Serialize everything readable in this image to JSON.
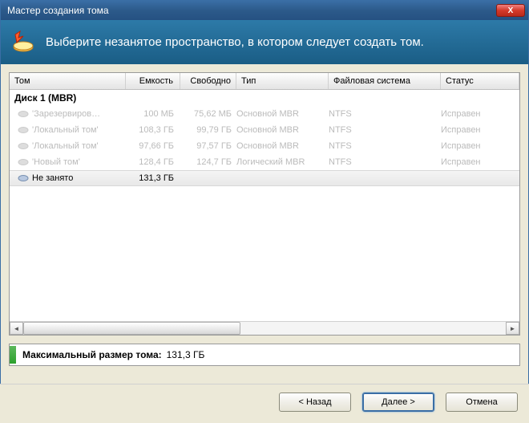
{
  "window": {
    "title": "Мастер создания тома",
    "close_x": "X"
  },
  "banner": {
    "text": "Выберите незанятое пространство, в котором следует создать том."
  },
  "table": {
    "headers": {
      "tom": "Том",
      "cap": "Емкость",
      "free": "Свободно",
      "type": "Тип",
      "fs": "Файловая система",
      "status": "Статус"
    },
    "disk_header": "Диск 1 (MBR)",
    "rows": [
      {
        "name": "'Зарезервиров…",
        "cap": "100 МБ",
        "free": "75,62 МБ",
        "type": "Основной MBR",
        "fs": "NTFS",
        "status": "Исправен",
        "dim": true
      },
      {
        "name": "'Локальный том'",
        "cap": "108,3 ГБ",
        "free": "99,79 ГБ",
        "type": "Основной MBR",
        "fs": "NTFS",
        "status": "Исправен",
        "dim": true
      },
      {
        "name": "'Локальный том'",
        "cap": "97,66 ГБ",
        "free": "97,57 ГБ",
        "type": "Основной MBR",
        "fs": "NTFS",
        "status": "Исправен",
        "dim": true
      },
      {
        "name": "'Новый том'",
        "cap": "128,4 ГБ",
        "free": "124,7 ГБ",
        "type": "Логический MBR",
        "fs": "NTFS",
        "status": "Исправен",
        "dim": true
      },
      {
        "name": "Не занято",
        "cap": "131,3 ГБ",
        "free": "",
        "type": "",
        "fs": "",
        "status": "",
        "dim": false,
        "sel": true
      }
    ]
  },
  "size_info": {
    "label": "Максимальный размер тома:",
    "value": "131,3 ГБ"
  },
  "buttons": {
    "back": "< Назад",
    "next": "Далее >",
    "cancel": "Отмена"
  }
}
